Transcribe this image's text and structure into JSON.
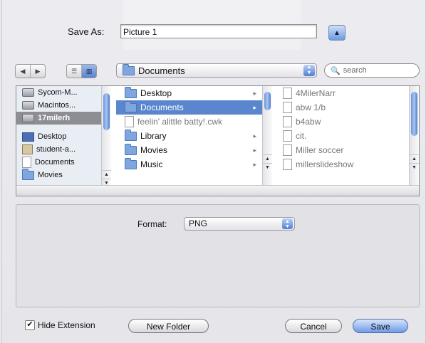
{
  "save_as": {
    "label": "Save As:",
    "filename": "Picture 1"
  },
  "toolbar": {
    "back_glyph": "◀",
    "forward_glyph": "▶",
    "list_view_glyph": "☰",
    "column_view_glyph": "▥",
    "location": "Documents",
    "search_placeholder": "search",
    "search_glyph": "🔍"
  },
  "sidebar": {
    "items": [
      {
        "label": "Sycom-M...",
        "icon": "hard-drive-icon"
      },
      {
        "label": "Macintos...",
        "icon": "hard-drive-icon"
      },
      {
        "label": "17milerh",
        "icon": "network-drive-icon",
        "selected": true
      },
      {
        "label": "Desktop",
        "icon": "desktop-icon"
      },
      {
        "label": "student-a...",
        "icon": "home-icon"
      },
      {
        "label": "Documents",
        "icon": "document-icon"
      },
      {
        "label": "Movies",
        "icon": "movie-folder-icon"
      }
    ]
  },
  "column2": {
    "items": [
      {
        "label": "Desktop",
        "folder": true
      },
      {
        "label": "Documents",
        "folder": true,
        "selected": true
      },
      {
        "label": "feelin' alittle batty!.cwk",
        "folder": false,
        "dim": true
      },
      {
        "label": "Library",
        "folder": true
      },
      {
        "label": "Movies",
        "folder": true
      },
      {
        "label": "Music",
        "folder": true
      }
    ]
  },
  "column3": {
    "items": [
      {
        "label": "4MilerNarr"
      },
      {
        "label": "abw 1/b"
      },
      {
        "label": "b4abw"
      },
      {
        "label": "cit."
      },
      {
        "label": "Miller soccer"
      },
      {
        "label": "millerslideshow"
      }
    ]
  },
  "options": {
    "format_label": "Format:",
    "format_value": "PNG"
  },
  "footer": {
    "hide_extension_label": "Hide Extension",
    "hide_extension_checked": true,
    "check_glyph": "✔",
    "new_folder_label": "New Folder",
    "cancel_label": "Cancel",
    "save_label": "Save"
  },
  "glyphs": {
    "chevron_right": "▸",
    "arrow_up": "▲",
    "arrow_down": "▼",
    "disclosure": "▲"
  },
  "colors": {
    "selection": "#5a86cf",
    "aqua_blue": "#6f9be6"
  }
}
